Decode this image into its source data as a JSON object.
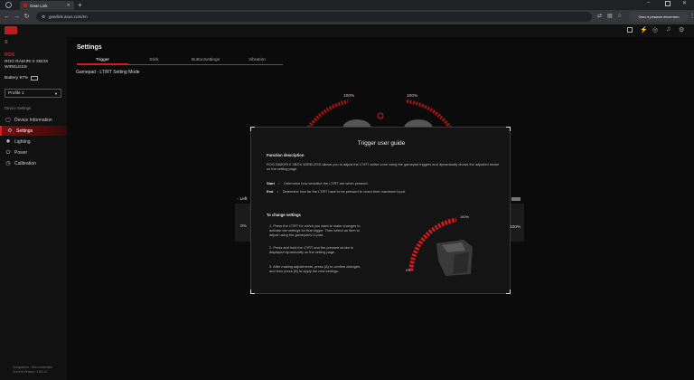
{
  "browser": {
    "tab_title": "Gear Link",
    "url": "gearlink.asus.com/en",
    "notice": "Окно в режиме инкогнито"
  },
  "app": {
    "device_brand": "ROG",
    "device_name_line1": "ROG RAIKIRI II XBOX",
    "device_name_line2": "WIRELESS",
    "battery": "Battery 97%",
    "profile": "Profile 1",
    "device_settings_label": "Device Settings",
    "sidebar_items": [
      {
        "label": "Device Information",
        "icon": "info-icon"
      },
      {
        "label": "Settings",
        "icon": "settings-icon"
      },
      {
        "label": "Lighting",
        "icon": "lighting-icon"
      },
      {
        "label": "Power",
        "icon": "power-icon"
      },
      {
        "label": "Calibration",
        "icon": "calibration-icon"
      }
    ],
    "footer_line1": "Companion - Not connected",
    "footer_line2": "Current Version: 1.00.12"
  },
  "main": {
    "title": "Settings",
    "tabs": [
      "Trigger",
      "Stick",
      "ButtonSettings",
      "Vibration"
    ],
    "active_tab": "Trigger",
    "subtitle": "Gamepad - LT/RT Setting Mode",
    "left_pct": "100%",
    "right_pct": "100%",
    "left_label": "Left",
    "zero_label": "0%",
    "right_end_label": "100%"
  },
  "modal": {
    "title": "Trigger user guide",
    "function_description_heading": "Function description",
    "description": "ROG RAIKIRI II XBOX WIRELESS allows you to adjust the LT/RT active zone using the gamepad triggers and dynamically shows the adjusted stroke on the setting page.",
    "start_label": "Start",
    "start_text": "Determine how sensitive the LT/RT are when pressed.",
    "end_label": "End",
    "end_text": "Determine how far the LT/RT have to be pressed to reach their maximum input.",
    "to_change_heading": "To change settings",
    "steps": [
      "1. Press the LT/RT for which you want to make changes to activate the settings for that trigger. Then select an item to adjust using the gamepad's D-pad.",
      "2. Press and hold the LT/RT and the pressed stroke is displayed dynamically on the setting page.",
      "3. After making adjustments, press (A) to confirm changes, and then press (B) to apply the new settings."
    ],
    "gauge_max": "100%",
    "gauge_min": "0%"
  },
  "colors": {
    "accent": "#d51b1b",
    "background": "#0b0b0b"
  }
}
